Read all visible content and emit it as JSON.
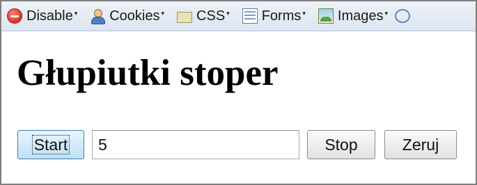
{
  "toolbar": {
    "items": [
      {
        "label": "Disable",
        "icon": "disable-icon"
      },
      {
        "label": "Cookies",
        "icon": "cookies-icon"
      },
      {
        "label": "CSS",
        "icon": "css-icon"
      },
      {
        "label": "Forms",
        "icon": "forms-icon"
      },
      {
        "label": "Images",
        "icon": "images-icon"
      }
    ],
    "dropdown_arrow": "▾"
  },
  "page": {
    "title": "Głupiutki stoper",
    "start_label": "Start",
    "counter_value": "5",
    "stop_label": "Stop",
    "reset_label": "Zeruj"
  }
}
